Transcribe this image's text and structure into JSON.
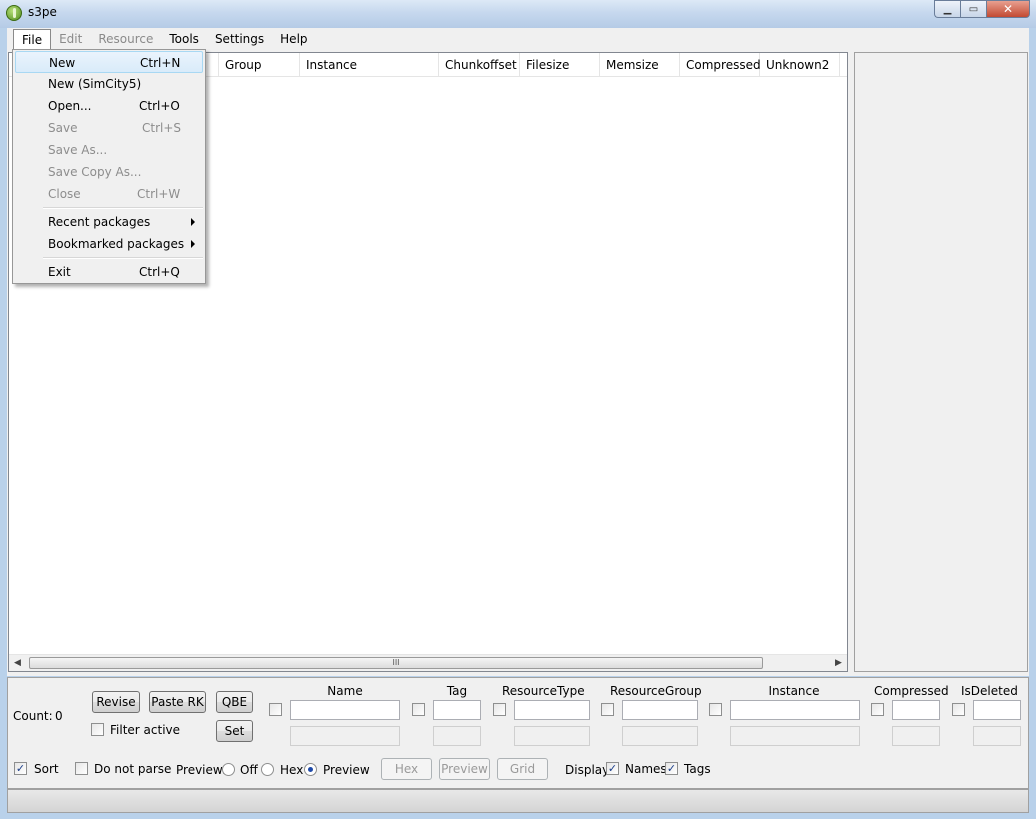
{
  "window": {
    "title": "s3pe",
    "close_glyph": "✕",
    "min_glyph": "▁",
    "max_glyph": "▭"
  },
  "menubar": [
    {
      "label": "File",
      "state": "open"
    },
    {
      "label": "Edit",
      "state": "disabled"
    },
    {
      "label": "Resource",
      "state": "disabled"
    },
    {
      "label": "Tools",
      "state": "enabled"
    },
    {
      "label": "Settings",
      "state": "enabled"
    },
    {
      "label": "Help",
      "state": "enabled"
    }
  ],
  "file_menu": {
    "new": {
      "label": "New",
      "shortcut": "Ctrl+N"
    },
    "new_simcity5": {
      "label": "New (SimCity5)"
    },
    "open": {
      "label": "Open...",
      "shortcut": "Ctrl+O"
    },
    "save": {
      "label": "Save",
      "shortcut": "Ctrl+S"
    },
    "save_as": {
      "label": "Save As..."
    },
    "save_copy_as": {
      "label": "Save Copy As..."
    },
    "close": {
      "label": "Close",
      "shortcut": "Ctrl+W"
    },
    "recent_packages": {
      "label": "Recent packages"
    },
    "bookmarked_packages": {
      "label": "Bookmarked packages"
    },
    "exit": {
      "label": "Exit",
      "shortcut": "Ctrl+Q"
    }
  },
  "list_columns": [
    "Group",
    "Instance",
    "Chunkoffset",
    "Filesize",
    "Memsize",
    "Compressed",
    "Unknown2"
  ],
  "scrollbar": {
    "thumb_glyph": "III"
  },
  "bottom_panel": {
    "count_label": "Count:",
    "count_value": "0",
    "revise": "Revise",
    "paste_rk": "Paste RK",
    "qbe": "QBE",
    "set": "Set",
    "filter_active": "Filter active",
    "filter_headers": {
      "name": "Name",
      "tag": "Tag",
      "resource_type": "ResourceType",
      "resource_group": "ResourceGroup",
      "instance": "Instance",
      "compressed": "Compressed",
      "is_deleted": "IsDeleted"
    },
    "sort": "Sort",
    "do_not_parse": "Do not parse",
    "preview_label": "Preview:",
    "preview_off": "Off",
    "preview_hex": "Hex",
    "preview_preview": "Preview",
    "hex_button": "Hex",
    "preview_button": "Preview",
    "grid_button": "Grid",
    "display_label": "Display:",
    "names": "Names",
    "tags": "Tags",
    "check_glyph": "✓"
  }
}
